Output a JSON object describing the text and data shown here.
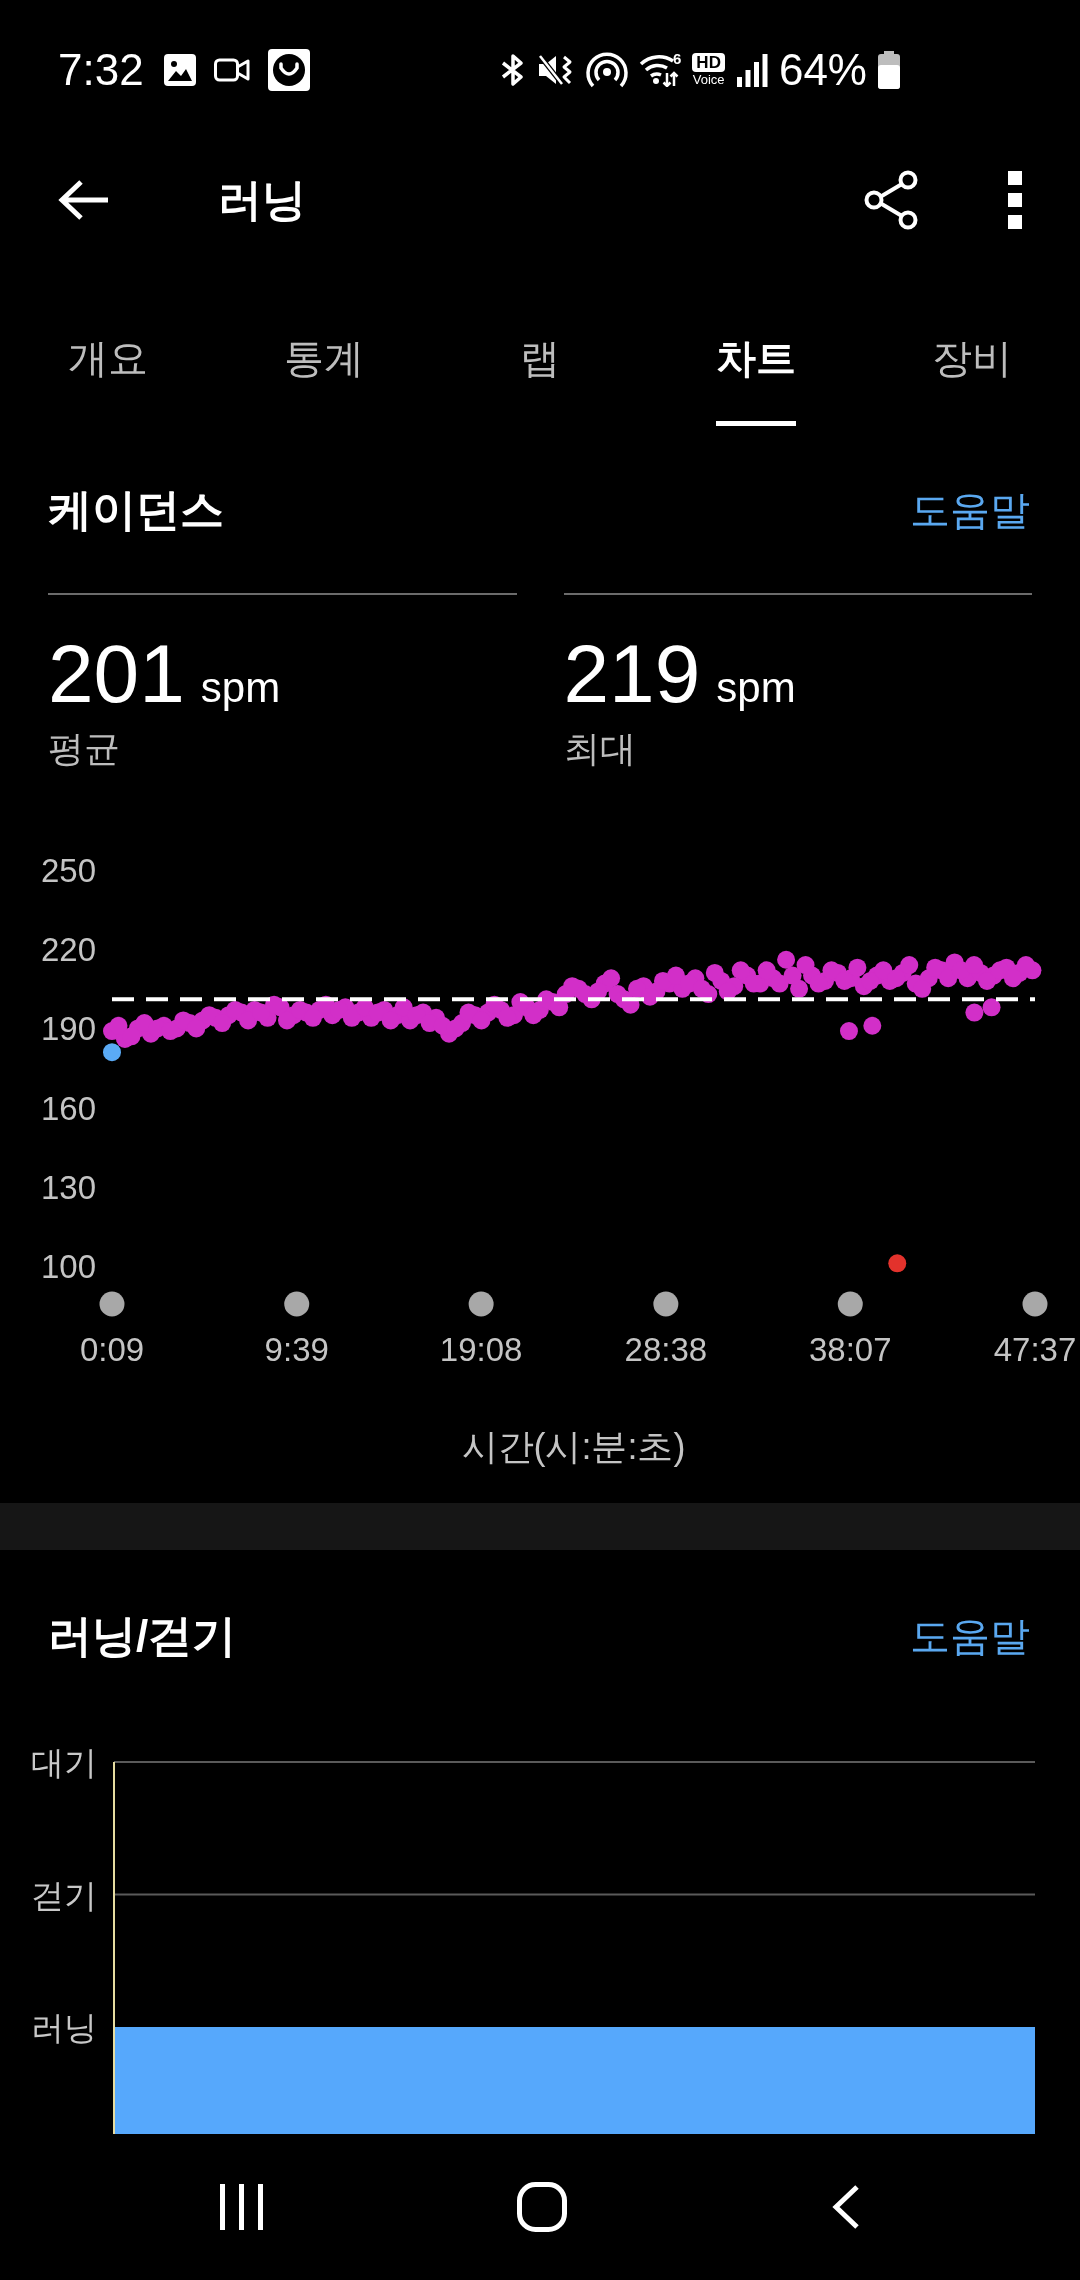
{
  "status_bar": {
    "time": "7:32",
    "wifi_label": "6",
    "hd_label": "HD",
    "voice_label": "Voice",
    "battery_percent": "64%"
  },
  "app_bar": {
    "title": "러닝"
  },
  "tabs": [
    {
      "label": "개요",
      "selected": false
    },
    {
      "label": "통계",
      "selected": false
    },
    {
      "label": "랩",
      "selected": false
    },
    {
      "label": "차트",
      "selected": true
    },
    {
      "label": "장비",
      "selected": false
    }
  ],
  "cadence_section": {
    "title": "케이던스",
    "help_link": "도움말",
    "stats": [
      {
        "value": "201",
        "unit": "spm",
        "label": "평균"
      },
      {
        "value": "219",
        "unit": "spm",
        "label": "최대"
      }
    ],
    "chart_data": {
      "type": "scatter",
      "xlabel": "시간(시:분:초)",
      "x": [
        9,
        49,
        89,
        129,
        169,
        209,
        249,
        289,
        329,
        369,
        409,
        449,
        489,
        529,
        569,
        609,
        649,
        689,
        729,
        769,
        809,
        849,
        889,
        929,
        969,
        1009,
        1049,
        1089,
        1129,
        1169,
        1209,
        1249,
        1289,
        1329,
        1369,
        1409,
        1449,
        1489,
        1529,
        1569,
        1609,
        1649,
        1689,
        1729,
        1769,
        1809,
        1849,
        1889,
        1929,
        1969,
        2009,
        2049,
        2089,
        2129,
        2169,
        2209,
        2249,
        2289,
        2329,
        2369,
        2409,
        2449,
        2489,
        2529,
        2569,
        2609,
        2649,
        2689,
        2729,
        2769,
        2809,
        2849,
        2283,
        2355,
        2670,
        2723,
        2432,
        29,
        69,
        109,
        149,
        189,
        229,
        269,
        309,
        349,
        389,
        429,
        469,
        509,
        549,
        589,
        629,
        669,
        709,
        749,
        789,
        829,
        869,
        909,
        949,
        989,
        1029,
        1069,
        1109,
        1149,
        1189,
        1229,
        1269,
        1309,
        1349,
        1389,
        1429,
        1469,
        1509,
        1549,
        1589,
        1629,
        1669,
        1709,
        1749,
        1789,
        1829,
        1869,
        1909,
        1949,
        1989,
        2029,
        2069,
        2109,
        2149,
        2189,
        2229,
        2269,
        2309,
        2349,
        2389,
        2429,
        2469,
        2509,
        2549,
        2589,
        2629,
        2669,
        2709,
        2749,
        2789,
        2829
      ],
      "series": [
        {
          "color": "#d22fc8",
          "values": [
            189,
            186,
            190,
            188,
            191,
            190,
            192,
            193,
            194,
            195,
            196,
            197,
            194,
            198,
            195,
            196,
            197,
            195,
            198,
            196,
            194,
            197,
            195,
            193,
            196,
            194,
            188,
            192,
            195,
            196,
            197,
            195,
            198,
            197,
            200,
            203,
            205,
            201,
            207,
            203,
            199,
            206,
            204,
            207,
            205,
            209,
            203,
            208,
            206,
            210,
            207,
            209,
            216,
            205,
            210,
            208,
            211,
            209,
            206,
            210,
            208,
            211,
            207,
            209,
            212,
            215,
            209,
            211,
            210,
            213,
            211,
            212,
            189,
            191,
            196,
            198,
            null,
            191,
            187,
            192,
            190,
            189,
            193,
            190,
            195,
            192,
            197,
            193,
            196,
            199,
            193,
            197,
            194,
            199,
            197,
            194,
            198,
            196,
            193,
            198,
            195,
            192,
            191,
            190,
            196,
            193,
            199,
            194,
            200,
            195,
            201,
            198,
            206,
            203,
            204,
            209,
            201,
            205,
            202,
            208,
            210,
            207,
            205,
            211,
            204,
            212,
            207,
            212,
            207,
            210,
            214,
            207,
            212,
            208,
            213,
            208,
            212,
            209,
            214,
            205,
            213,
            209,
            212,
            214,
            208,
            212,
            209,
            214
          ]
        },
        {
          "color": "#5aaaf5",
          "values": [
            181,
            null,
            null,
            null,
            null,
            null,
            null,
            null,
            null,
            null,
            null,
            null,
            null,
            null,
            null,
            null,
            null,
            null,
            null,
            null,
            null,
            null,
            null,
            null,
            null,
            null,
            null,
            null,
            null,
            null,
            null,
            null,
            null,
            null,
            null,
            null,
            null,
            null,
            null,
            null,
            null,
            null,
            null,
            null,
            null,
            null,
            null,
            null,
            null,
            null,
            null,
            null,
            null,
            null,
            null,
            null,
            null,
            null,
            null,
            null,
            null,
            null,
            null,
            null,
            null,
            null,
            null,
            null,
            null,
            null,
            null,
            null,
            null,
            null,
            null,
            null,
            null,
            null,
            null,
            null,
            null,
            null,
            null,
            null,
            null,
            null,
            null,
            null,
            null,
            null,
            null,
            null,
            null,
            null,
            null,
            null,
            null,
            null,
            null,
            null,
            null,
            null,
            null,
            null,
            null,
            null,
            null,
            null,
            null,
            null,
            null,
            null,
            null,
            null,
            null,
            null,
            null,
            null,
            null,
            null,
            null,
            null,
            null,
            null,
            null,
            null,
            null,
            null,
            null,
            null,
            null,
            null,
            null,
            null,
            null,
            null,
            null,
            null,
            null,
            null,
            null,
            null,
            null,
            null,
            null,
            null,
            null,
            null
          ]
        },
        {
          "color": "#e3322c",
          "values": [
            null,
            null,
            null,
            null,
            null,
            null,
            null,
            null,
            null,
            null,
            null,
            null,
            null,
            null,
            null,
            null,
            null,
            null,
            null,
            null,
            null,
            null,
            null,
            null,
            null,
            null,
            null,
            null,
            null,
            null,
            null,
            null,
            null,
            null,
            null,
            null,
            null,
            null,
            null,
            null,
            null,
            null,
            null,
            null,
            null,
            null,
            null,
            null,
            null,
            null,
            null,
            null,
            null,
            null,
            null,
            null,
            null,
            null,
            null,
            null,
            null,
            null,
            null,
            null,
            null,
            null,
            null,
            null,
            null,
            null,
            null,
            null,
            null,
            null,
            null,
            null,
            101,
            null,
            null,
            null,
            null,
            null,
            null,
            null,
            null,
            null,
            null,
            null,
            null,
            null,
            null,
            null,
            null,
            null,
            null,
            null,
            null,
            null,
            null,
            null,
            null,
            null,
            null,
            null,
            null,
            null,
            null,
            null,
            null,
            null,
            null,
            null,
            null,
            null,
            null,
            null,
            null,
            null,
            null,
            null,
            null,
            null,
            null,
            null,
            null,
            null,
            null,
            null,
            null,
            null,
            null,
            null,
            null,
            null,
            null,
            null,
            null,
            null,
            null,
            null,
            null,
            null,
            null,
            null,
            null,
            null,
            null,
            null
          ]
        }
      ],
      "xlim": [
        9,
        2857
      ],
      "ylim": [
        100,
        250
      ],
      "xticks": [
        {
          "value": 9,
          "label": "0:09"
        },
        {
          "value": 579,
          "label": "9:39"
        },
        {
          "value": 1148,
          "label": "19:08"
        },
        {
          "value": 1718,
          "label": "28:38"
        },
        {
          "value": 2287,
          "label": "38:07"
        },
        {
          "value": 2857,
          "label": "47:37"
        }
      ],
      "yticks": [
        100,
        130,
        160,
        190,
        220,
        250
      ],
      "ref_lines": [
        {
          "axis": "y",
          "value": 201
        }
      ]
    }
  },
  "run_walk_section": {
    "title": "러닝/걷기",
    "help_link": "도움말",
    "levels": [
      {
        "label": "대기",
        "selected": false
      },
      {
        "label": "걷기",
        "selected": false
      },
      {
        "label": "러닝",
        "selected": true
      }
    ]
  }
}
